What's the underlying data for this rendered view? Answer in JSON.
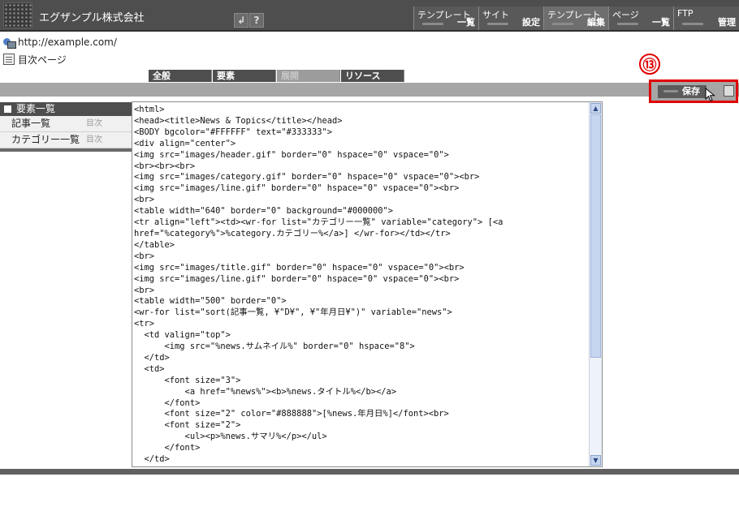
{
  "header": {
    "company": "エグザンプル株式会社",
    "help_icon": "?",
    "nav": [
      {
        "top": "テンプレート",
        "bottom": "一覧"
      },
      {
        "top": "サイト",
        "bottom": "設定"
      },
      {
        "top": "テンプレート",
        "bottom": "編集"
      },
      {
        "top": "ページ",
        "bottom": "一覧"
      },
      {
        "top": "FTP",
        "bottom": "管理"
      }
    ]
  },
  "site": {
    "url": "http://example.com/",
    "page": "目次ページ"
  },
  "tabs": [
    "全般",
    "要素",
    "展開",
    "リソース"
  ],
  "badge": "⑬",
  "save_label": "保存",
  "sidebar": {
    "title": "要素一覧",
    "items": [
      {
        "label": "記事一覧",
        "sub": "目次"
      },
      {
        "label": "カテゴリー一覧",
        "sub": "目次"
      }
    ]
  },
  "editor": {
    "code": "<html>\n<head><title>News & Topics</title></head>\n<BODY bgcolor=\"#FFFFFF\" text=\"#333333\">\n<div align=\"center\">\n<img src=\"images/header.gif\" border=\"0\" hspace=\"0\" vspace=\"0\">\n<br><br><br>\n<img src=\"images/category.gif\" border=\"0\" hspace=\"0\" vspace=\"0\"><br>\n<img src=\"images/line.gif\" border=\"0\" hspace=\"0\" vspace=\"0\"><br>\n<br>\n<table width=\"640\" border=\"0\" background=\"#000000\">\n<tr align=\"left\"><td><wr-for list=\"カテゴリー一覧\" variable=\"category\"> [<a\nhref=\"%category%\">%category.カテゴリー%</a>] </wr-for></td></tr>\n</table>\n<br>\n<img src=\"images/title.gif\" border=\"0\" hspace=\"0\" vspace=\"0\"><br>\n<img src=\"images/line.gif\" border=\"0\" hspace=\"0\" vspace=\"0\"><br>\n<br>\n<table width=\"500\" border=\"0\">\n<wr-for list=\"sort(記事一覧, ¥\"D¥\", ¥\"年月日¥\")\" variable=\"news\">\n<tr>\n  <td valign=\"top\">\n      <img src=\"%news.サムネイル%\" border=\"0\" hspace=\"8\">\n  </td>\n  <td>\n      <font size=\"3\">\n          <a href=\"%news%\"><b>%news.タイトル%</b></a>\n      </font>\n      <font size=\"2\" color=\"#888888\">[%news.年月日%]</font><br>\n      <font size=\"2\">\n          <ul><p>%news.サマリ%</p></ul>\n      </font>\n  </td>"
  }
}
